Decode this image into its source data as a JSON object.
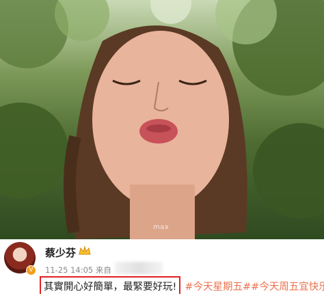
{
  "photo": {
    "watermark": "max"
  },
  "post": {
    "username": "蔡少芬",
    "timestamp": "11-25 14:05 来自",
    "text": "其實開心好簡單，最緊要好玩!",
    "hashtags": "#今天星期五##今天周五宜快乐",
    "colors": {
      "hashtag": "#eb7350",
      "highlight_border": "#e02020"
    }
  }
}
